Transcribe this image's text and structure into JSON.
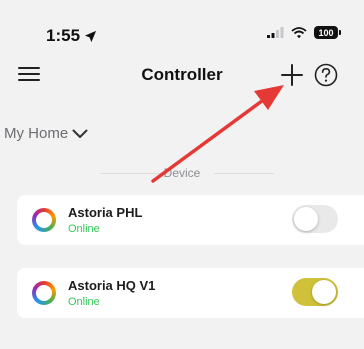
{
  "status_bar": {
    "time": "1:55",
    "battery": "100",
    "icons": [
      "location-arrow-icon",
      "signal-icon",
      "wifi-icon",
      "battery-icon"
    ]
  },
  "nav": {
    "title": "Controller",
    "icons": [
      "menu-icon",
      "plus-icon",
      "help-icon"
    ]
  },
  "home_selector": {
    "label": "My Home",
    "icon": "chevron-down-icon"
  },
  "section": {
    "label": "Device"
  },
  "devices": [
    {
      "name": "Astoria PHL",
      "status": "Online",
      "enabled": false
    },
    {
      "name": "Astoria HQ V1",
      "status": "Online",
      "enabled": true
    }
  ],
  "colors": {
    "background": "#f2f2f2",
    "online": "#34c759",
    "toggle_on": "#cfc23a",
    "toggle_off": "#e9e9ea",
    "annotation_arrow": "#e53935"
  },
  "annotation": {
    "type": "arrow",
    "points_to": "add-button"
  }
}
